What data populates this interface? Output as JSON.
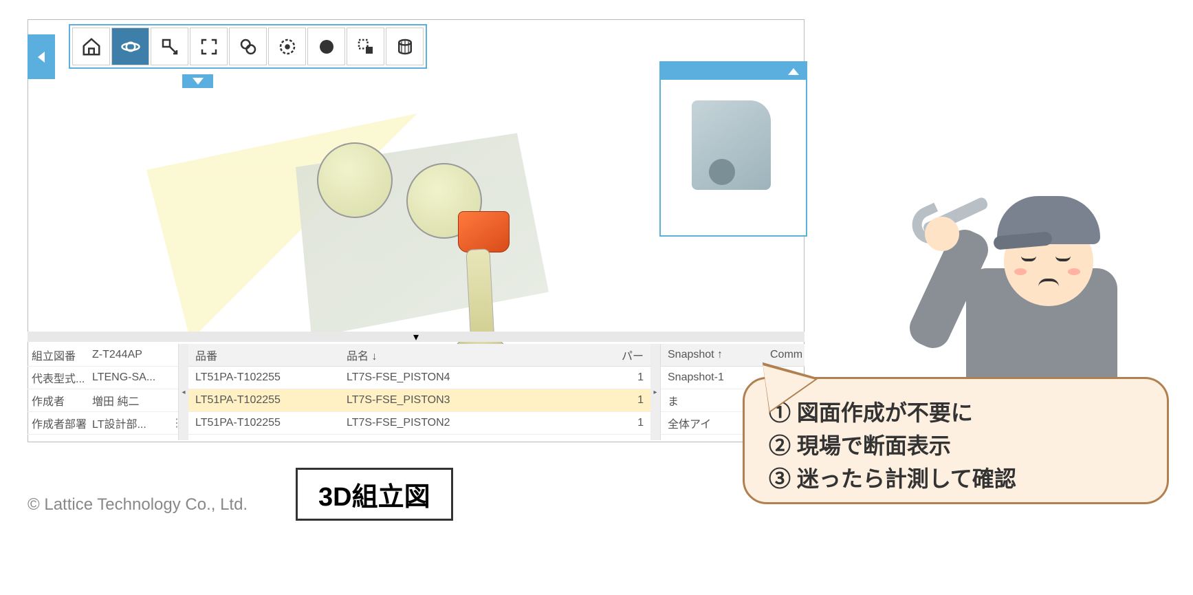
{
  "toolbar": {
    "icons": [
      "home-icon",
      "orbit-icon",
      "pan-icon",
      "fit-icon",
      "zoom-window-icon",
      "shade-circle-icon",
      "shade-fill-icon",
      "section-icon",
      "wireframe-icon"
    ]
  },
  "right_tools_a": [
    "section-vertical-icon",
    "section-top-icon",
    "section-box-icon",
    "section-free-icon",
    "select-section-icon",
    "settings-section-icon"
  ],
  "right_tools_b": [
    "measure-distance-icon",
    "measure-width-icon",
    "measure-depth-icon",
    "measure-circle-icon",
    "measure-select-icon",
    "measure-settings-icon"
  ],
  "properties": [
    {
      "label": "組立図番",
      "value": "Z-T244AP"
    },
    {
      "label": "代表型式...",
      "value": "LTENG-SA..."
    },
    {
      "label": "作成者",
      "value": "増田 純二"
    },
    {
      "label": "作成者部署",
      "value": "LT設計部..."
    }
  ],
  "parts_header": {
    "c1": "品番",
    "c2": "品名 ↓",
    "c3": "パー"
  },
  "parts_rows": [
    {
      "c1": "LT51PA-T102255",
      "c2": "LT7S-FSE_PISTON4",
      "c3": "1"
    },
    {
      "c1": "LT51PA-T102255",
      "c2": "LT7S-FSE_PISTON3",
      "c3": "1"
    },
    {
      "c1": "LT51PA-T102255",
      "c2": "LT7S-FSE_PISTON2",
      "c3": "1"
    }
  ],
  "snapshot_header": {
    "c1": "Snapshot ↑",
    "c2": "Comm"
  },
  "snapshot_rows": [
    "Snapshot-1",
    "ま",
    "全体アイ"
  ],
  "caption": "3D組立図",
  "copyright": "© Lattice Technology Co., Ltd.",
  "bubble": {
    "line1": "① 図面作成が不要に",
    "line2": "② 現場で断面表示",
    "line3": "③ 迷ったら計測して確認"
  }
}
